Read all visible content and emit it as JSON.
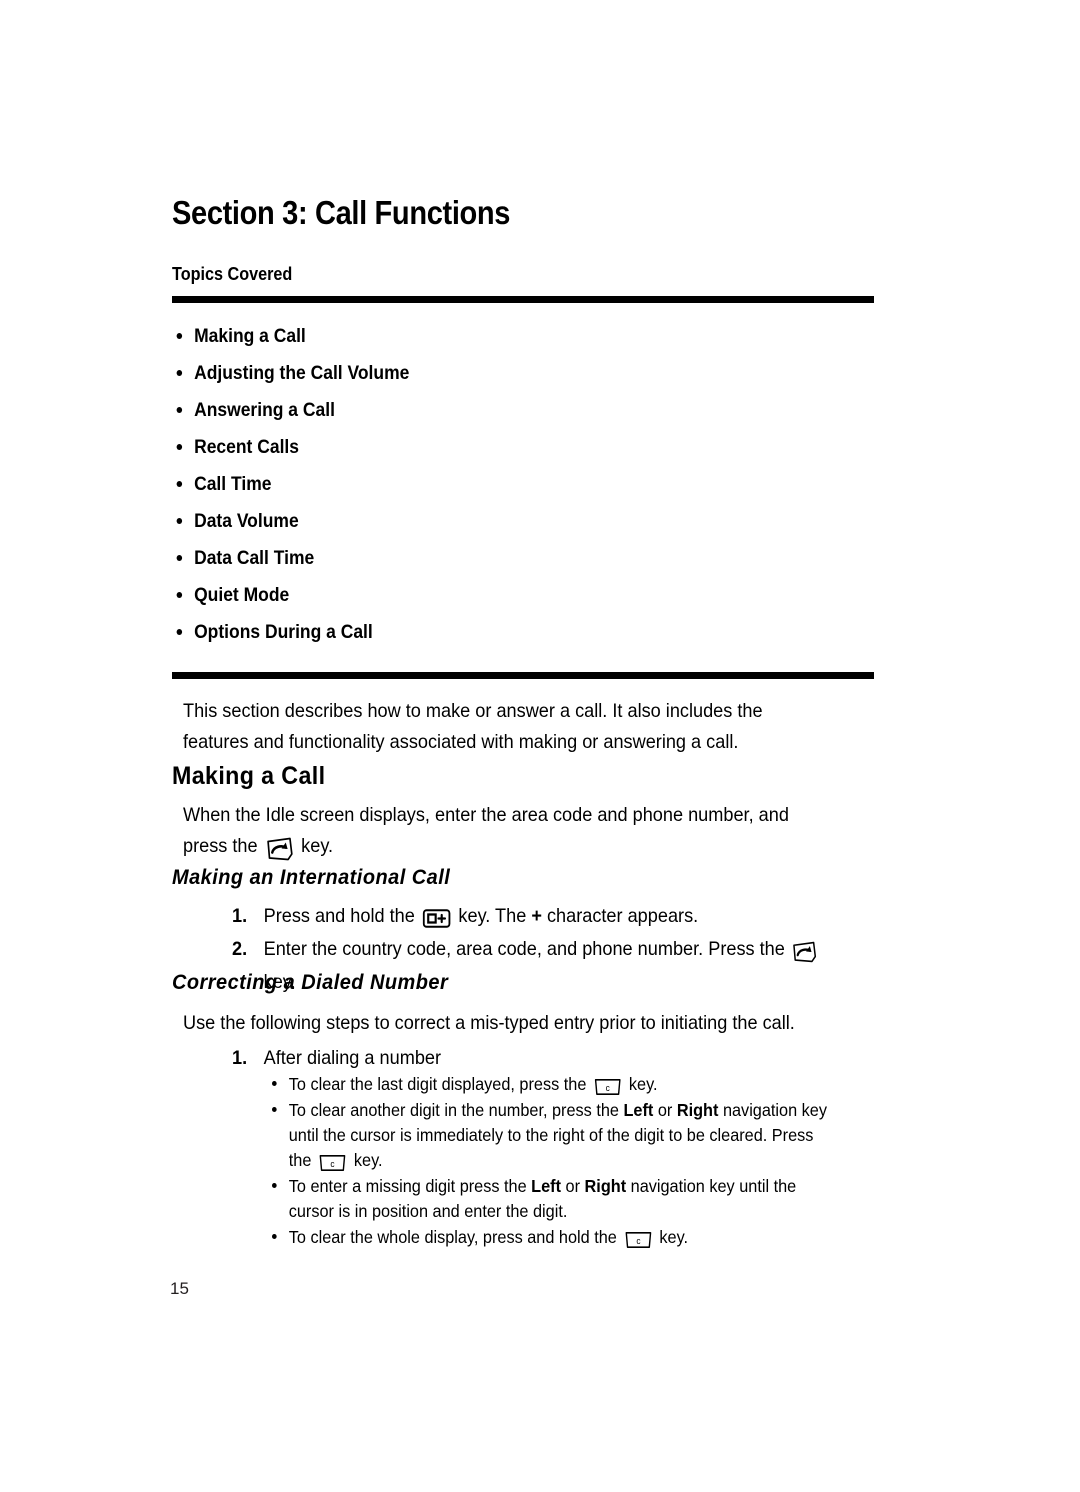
{
  "document": {
    "section_title": "Section 3: Call Functions",
    "topics_label": "Topics Covered",
    "page_number": "15"
  },
  "topics": [
    {
      "label": "Making a Call"
    },
    {
      "label": "Adjusting the Call Volume"
    },
    {
      "label": "Answering a Call"
    },
    {
      "label": "Recent Calls"
    },
    {
      "label": "Call Time"
    },
    {
      "label": "Data Volume"
    },
    {
      "label": "Data Call Time"
    },
    {
      "label": "Quiet Mode"
    },
    {
      "label": "Options During a Call"
    }
  ],
  "intro": {
    "paragraph": "This section describes how to make or answer a call. It also includes the features and functionality associated with making or answering a call."
  },
  "making_a_call": {
    "heading": "Making a Call",
    "body_before_key": "When the Idle screen displays, enter the area code and phone number, and press the",
    "body_after_key": "key."
  },
  "international": {
    "heading": "Making an International Call",
    "step1": {
      "number": "1.",
      "text_before_key": "Press and hold the",
      "text_mid": "key. The",
      "plus_char": "+",
      "text_after": "character appears."
    },
    "step2": {
      "number": "2.",
      "text_before_key": "Enter the country code, area code, and phone number. Press the",
      "text_after_key": "key."
    }
  },
  "correcting": {
    "heading": "Correcting a Dialed Number",
    "lead": "Use the following steps to correct a mis-typed entry prior to initiating the call.",
    "step1": {
      "number": "1.",
      "text": "After dialing a number"
    },
    "bullets": [
      {
        "parts": [
          {
            "t": "To clear the last digit displayed, press the ",
            "style": "normal"
          },
          {
            "t": "KEY_C",
            "style": "icon"
          },
          {
            "t": " key.",
            "style": "normal"
          }
        ]
      },
      {
        "parts": [
          {
            "t": "To clear another digit in the number, press the ",
            "style": "normal"
          },
          {
            "t": "Left",
            "style": "bold"
          },
          {
            "t": " or ",
            "style": "normal"
          },
          {
            "t": "Right",
            "style": "bold"
          },
          {
            "t": " navigation key until the cursor is immediately to the right of the digit to be cleared. Press the ",
            "style": "normal"
          },
          {
            "t": "KEY_C",
            "style": "icon"
          },
          {
            "t": " key.",
            "style": "normal"
          }
        ]
      },
      {
        "parts": [
          {
            "t": "To enter a missing digit press the ",
            "style": "normal"
          },
          {
            "t": "Left",
            "style": "bold"
          },
          {
            "t": " or ",
            "style": "normal"
          },
          {
            "t": "Right",
            "style": "bold"
          },
          {
            "t": " navigation key until the cursor is in position and enter the digit.",
            "style": "normal"
          }
        ]
      },
      {
        "parts": [
          {
            "t": "To clear the whole display, press and hold the ",
            "style": "normal"
          },
          {
            "t": "KEY_C",
            "style": "icon"
          },
          {
            "t": " key.",
            "style": "normal"
          }
        ]
      }
    ]
  },
  "icons": {
    "send_key": "send-call-key-icon",
    "zero_plus_key": "zero-plus-key-icon",
    "clear_key": "clear-c-key-icon"
  },
  "colors": {
    "text": "#000000",
    "background": "#ffffff",
    "rule": "#000000"
  }
}
